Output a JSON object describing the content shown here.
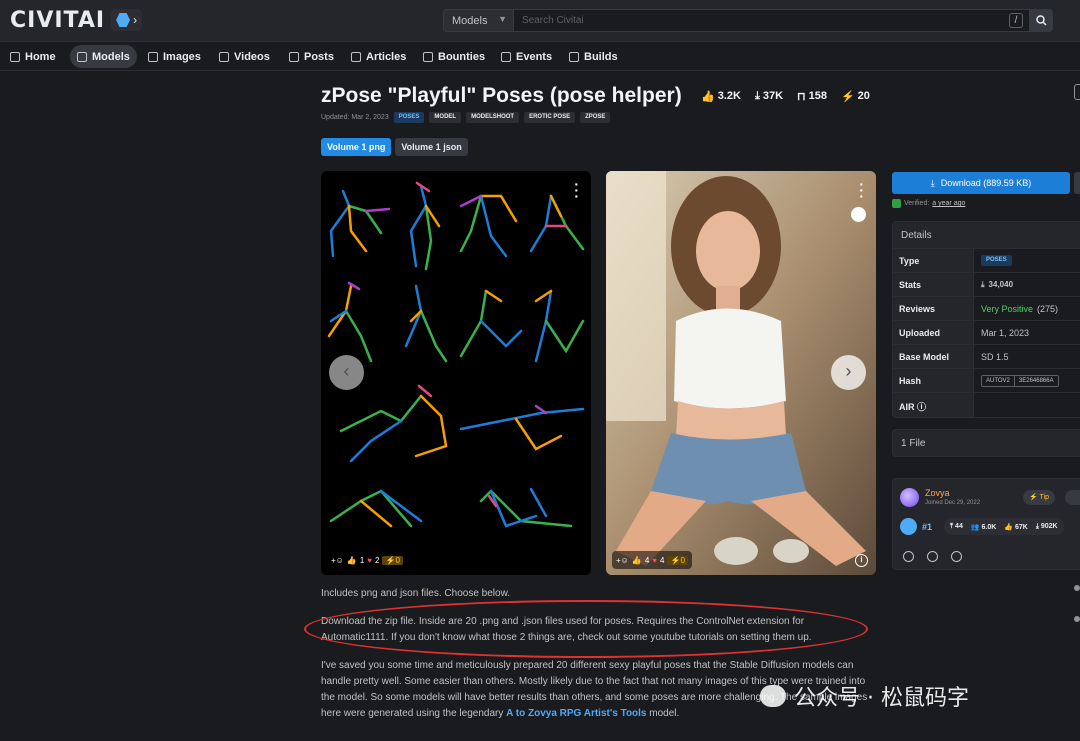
{
  "header": {
    "logo": "CIVITAI",
    "search_type": "Models",
    "search_placeholder": "Search Civitai",
    "search_shortcut": "/"
  },
  "nav": [
    {
      "label": "Home",
      "icon": "home-icon"
    },
    {
      "label": "Models",
      "icon": "grid-icon",
      "active": true
    },
    {
      "label": "Images",
      "icon": "image-icon"
    },
    {
      "label": "Videos",
      "icon": "video-icon"
    },
    {
      "label": "Posts",
      "icon": "posts-icon"
    },
    {
      "label": "Articles",
      "icon": "article-icon"
    },
    {
      "label": "Bounties",
      "icon": "bounty-icon"
    },
    {
      "label": "Events",
      "icon": "calendar-icon"
    },
    {
      "label": "Builds",
      "icon": "builds-icon"
    }
  ],
  "model": {
    "title": "zPose \"Playful\" Poses (pose helper)",
    "stats": {
      "likes": "3.2K",
      "downloads": "37K",
      "bookmarks": "158",
      "buzz": "20"
    },
    "updated": "Updated: Mar 2, 2023",
    "tags": [
      "POSES",
      "MODEL",
      "MODELSHOOT",
      "EROTIC POSE",
      "ZPOSE"
    ],
    "versions": [
      "Volume 1 png",
      "Volume 1 json"
    ]
  },
  "gallery": {
    "card1": {
      "reactions": {
        "like": "1",
        "heart": "2",
        "buzz": "0"
      }
    },
    "card2": {
      "reactions": {
        "like": "4",
        "heart": "4",
        "buzz": "0"
      }
    }
  },
  "sidebar": {
    "download_label": "Download (889.59 KB)",
    "verified_label": "Verified:",
    "verified_time": "a year ago",
    "details_title": "Details",
    "details": [
      {
        "key": "Type",
        "value": "POSES"
      },
      {
        "key": "Stats",
        "value": "34,040"
      },
      {
        "key": "Reviews",
        "value": "Very Positive",
        "extra": "(275)"
      },
      {
        "key": "Uploaded",
        "value": "Mar 1, 2023"
      },
      {
        "key": "Base Model",
        "value": "SD 1.5"
      },
      {
        "key": "Hash",
        "value": "AUTOV2",
        "extra": "3E2646866A"
      },
      {
        "key": "AIR",
        "value": ""
      }
    ],
    "files_label": "1 File",
    "creator": {
      "name": "Zovya",
      "joined": "Joined Dec 29, 2022",
      "tip_label": "Tip",
      "rank": "#1",
      "stats": [
        "44",
        "6.0K",
        "67K",
        "902K"
      ]
    }
  },
  "description": {
    "p1": "Includes png and json files. Choose below.",
    "p2": "Download the zip file. Inside are 20 .png and .json files used for poses. Requires the ControlNet extension for Automatic1111. If you don't know what those 2 things are, check out some youtube tutorials on setting them up.",
    "p3_before": "I've saved you some time and meticulously prepared 20 different sexy playful poses that the Stable Diffusion models can handle pretty well. Some easier than others. Mostly likely due to the fact that not many images of this type were trained into the model. So some models will have better results than others, and some poses are more challenging. The sample images here were generated using the legendary ",
    "p3_link": "A to Zovya RPG Artist's Tools",
    "p3_after": " model."
  },
  "watermark": "公众号 · 松鼠码字",
  "colors": {
    "accent": "#1c7ed6",
    "positive": "#51cf66",
    "highlight_circle": "#e03131"
  }
}
